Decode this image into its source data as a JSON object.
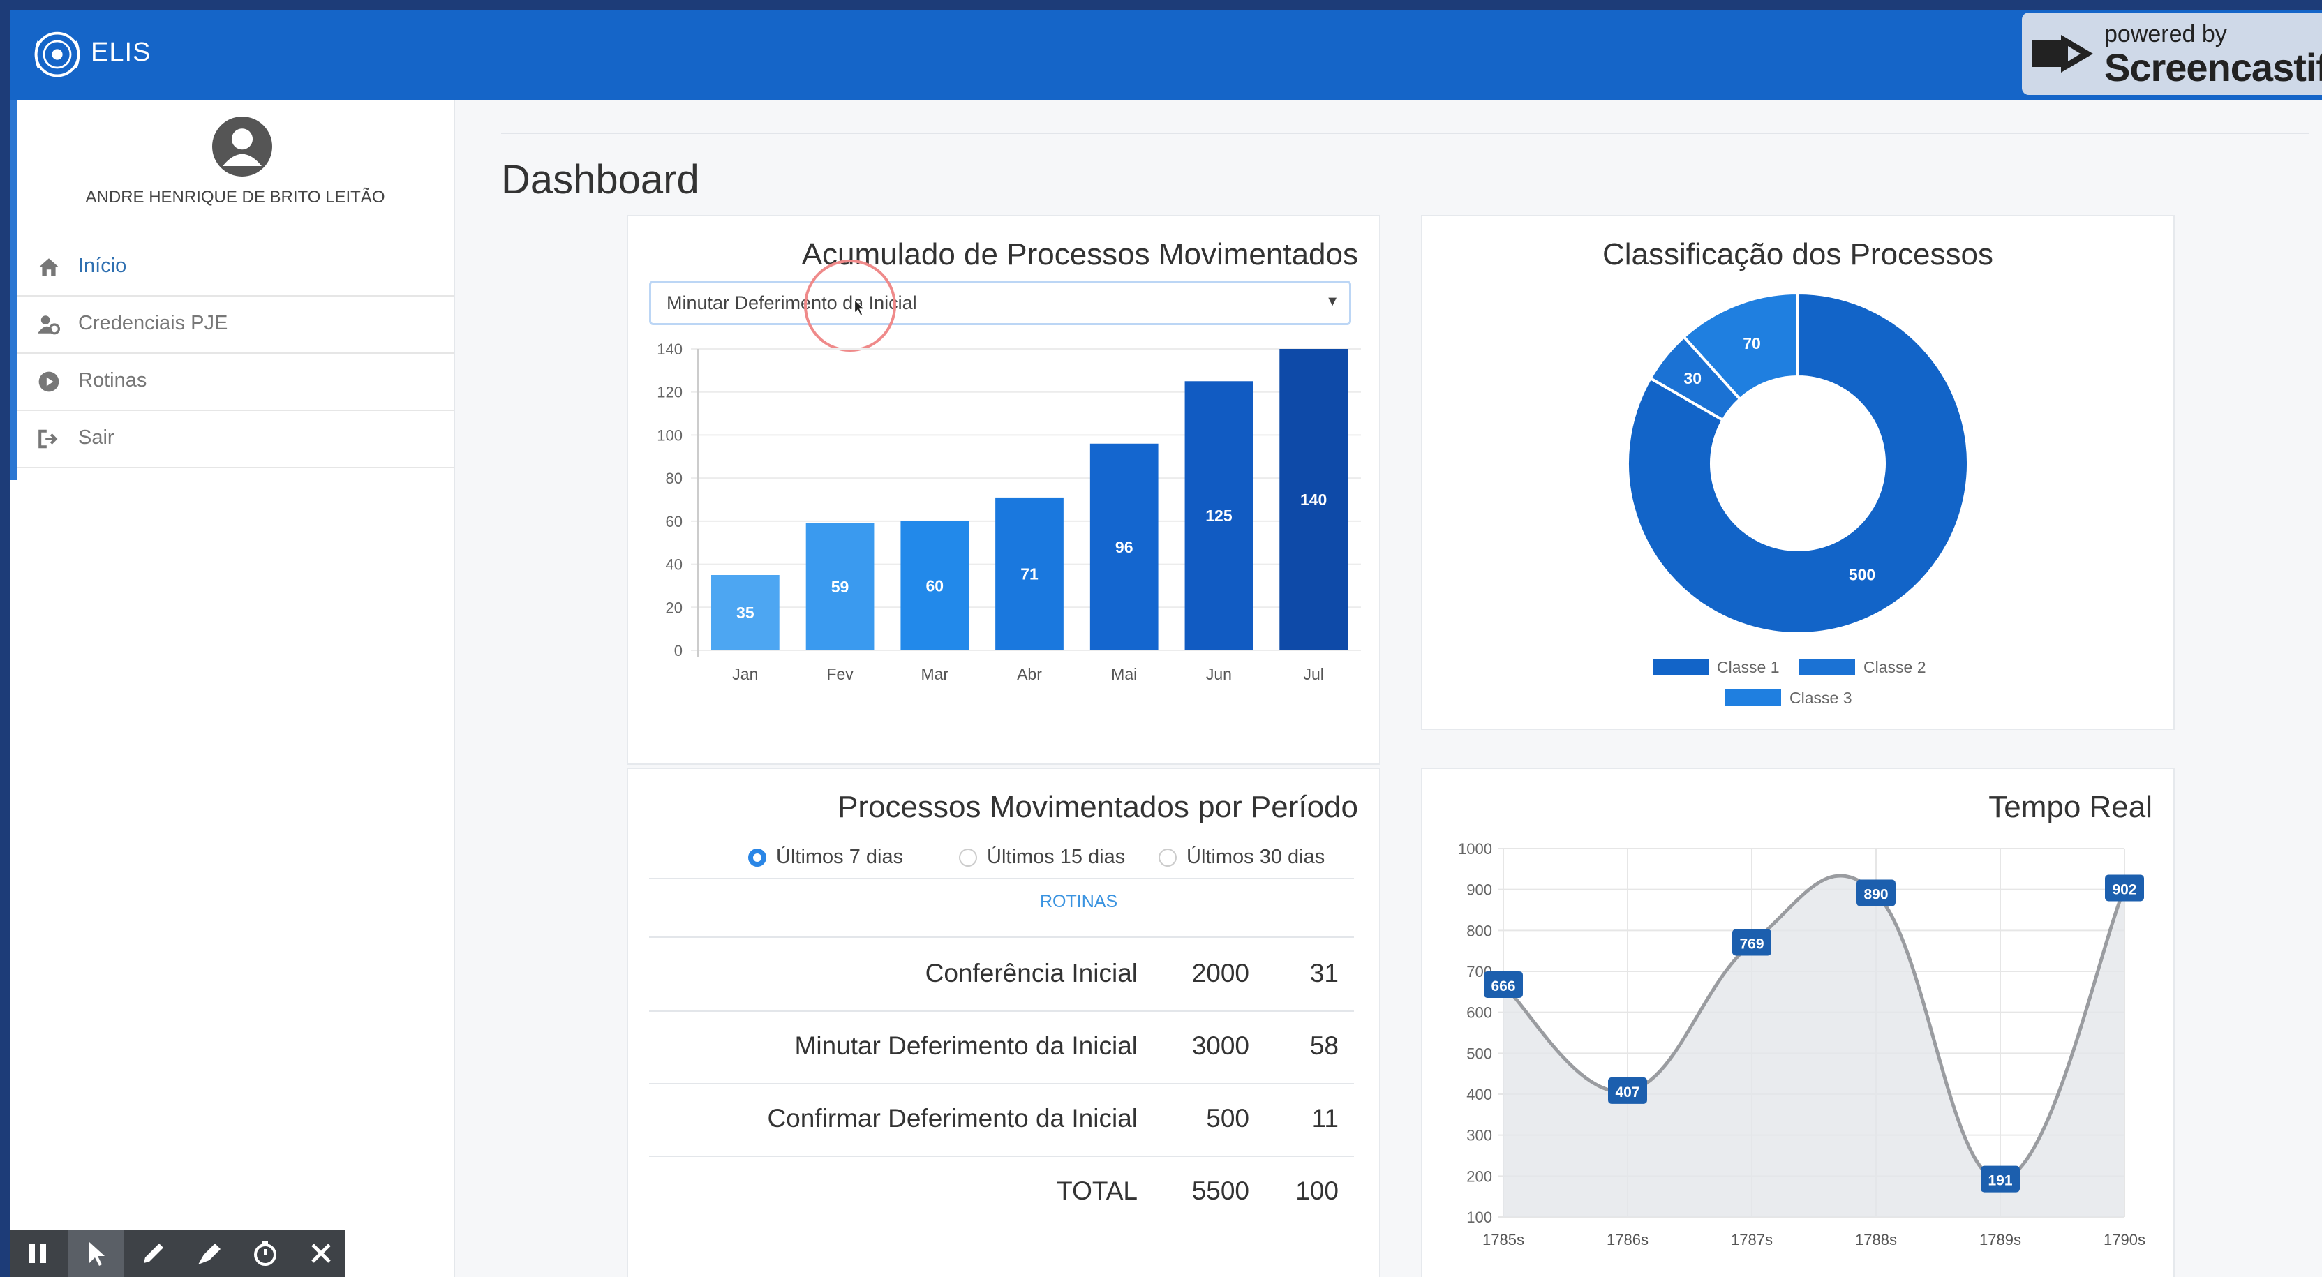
{
  "app": {
    "name": "ELIS"
  },
  "brand": {
    "powered_by": "powered by",
    "name": "Screencastify"
  },
  "user": {
    "name": "ANDRE HENRIQUE DE BRITO LEITÃO"
  },
  "nav": {
    "items": [
      {
        "label": "Início",
        "icon": "home-icon"
      },
      {
        "label": "Credenciais PJE",
        "icon": "user-gear-icon"
      },
      {
        "label": "Rotinas",
        "icon": "play-circle-icon"
      },
      {
        "label": "Sair",
        "icon": "sign-out-icon"
      }
    ]
  },
  "page": {
    "title": "Dashboard"
  },
  "acumulado": {
    "title": "Acumulado de Processos Movimentados",
    "select_value": "Minutar Deferimento da Inicial"
  },
  "classificacao": {
    "title": "Classificação dos Processos"
  },
  "periodo": {
    "title": "Processos Movimentados por Período",
    "options": [
      "Últimos 7 dias",
      "Últimos 15 dias",
      "Últimos 30 dias"
    ],
    "selected": "Últimos 7 dias",
    "header": "ROTINAS",
    "rows": [
      {
        "name": "Conferência Inicial",
        "a": "2000",
        "b": "31"
      },
      {
        "name": "Minutar Deferimento da Inicial",
        "a": "3000",
        "b": "58"
      },
      {
        "name": "Confirmar Deferimento da Inicial",
        "a": "500",
        "b": "11"
      }
    ],
    "total": {
      "name": "TOTAL",
      "a": "5500",
      "b": "100"
    }
  },
  "tempo_real": {
    "title": "Tempo Real"
  },
  "chart_data": [
    {
      "type": "bar",
      "categories": [
        "Jan",
        "Fev",
        "Mar",
        "Abr",
        "Mai",
        "Jun",
        "Jul"
      ],
      "values": [
        35,
        59,
        60,
        71,
        96,
        125,
        140
      ],
      "ylim": [
        0,
        140
      ],
      "yticks": [
        0,
        20,
        40,
        60,
        80,
        100,
        120,
        140
      ],
      "colors": [
        "#4da6f2",
        "#3a9aef",
        "#2289ea",
        "#1a78de",
        "#1466cf",
        "#115bc2",
        "#0e4aa8"
      ],
      "grid": true
    },
    {
      "type": "pie",
      "variant": "doughnut",
      "labels": [
        "Classe 1",
        "Classe 2",
        "Classe 3"
      ],
      "values": [
        500,
        30,
        70
      ],
      "colors": [
        "#1264c8",
        "#1b72d4",
        "#1f7fe0"
      ],
      "legend": "bottom"
    },
    {
      "type": "area",
      "x": [
        "1785s",
        "1786s",
        "1787s",
        "1788s",
        "1789s",
        "1790s"
      ],
      "y": [
        666,
        407,
        769,
        890,
        191,
        902
      ],
      "ylim": [
        100,
        1000
      ],
      "yticks": [
        100,
        200,
        300,
        400,
        500,
        600,
        700,
        800,
        900,
        1000
      ],
      "line_color": "#9a9ca0",
      "fill_color": "#e3e6ea",
      "label_color": "#1c5fae",
      "grid": true
    }
  ]
}
